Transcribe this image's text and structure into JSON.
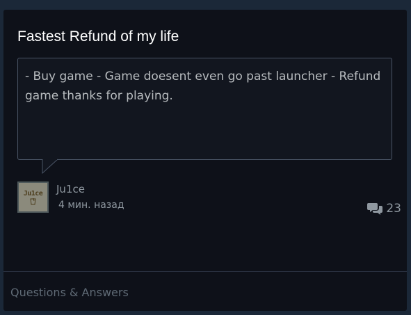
{
  "review": {
    "title": "Fastest Refund of my life",
    "body": "- Buy game - Game doesent even go past launcher - Refund game thanks for playing.",
    "author": "Ju1ce",
    "avatar_text": "Ju1ce",
    "posted": "4 мин. назад",
    "comment_count": "23",
    "comment_icon": "comments-icon"
  },
  "footer": {
    "category": "Questions & Answers"
  },
  "colors": {
    "page_bg": "#1b2838",
    "card_bg": "#0e1119",
    "title": "#ffffff",
    "muted_text": "#8f98a0",
    "border": "#4a5566"
  }
}
